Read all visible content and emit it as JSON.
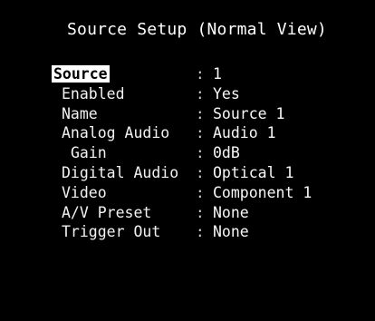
{
  "title": "Source Setup (Normal View)",
  "separator": ":",
  "rows": [
    {
      "label": "Source",
      "value": "1"
    },
    {
      "label": "Enabled",
      "value": "Yes"
    },
    {
      "label": "Name",
      "value": "Source 1"
    },
    {
      "label": "Analog Audio",
      "value": "Audio 1"
    },
    {
      "label": "Gain",
      "value": "0dB"
    },
    {
      "label": "Digital Audio",
      "value": "Optical 1"
    },
    {
      "label": "Video",
      "value": "Component 1"
    },
    {
      "label": "A/V Preset",
      "value": "None"
    },
    {
      "label": "Trigger Out",
      "value": "None"
    }
  ],
  "selected_item": "Source",
  "colors": {
    "background": "#000000",
    "text": "#ffffff",
    "highlight_bg": "#ffffff",
    "highlight_text": "#000000"
  }
}
